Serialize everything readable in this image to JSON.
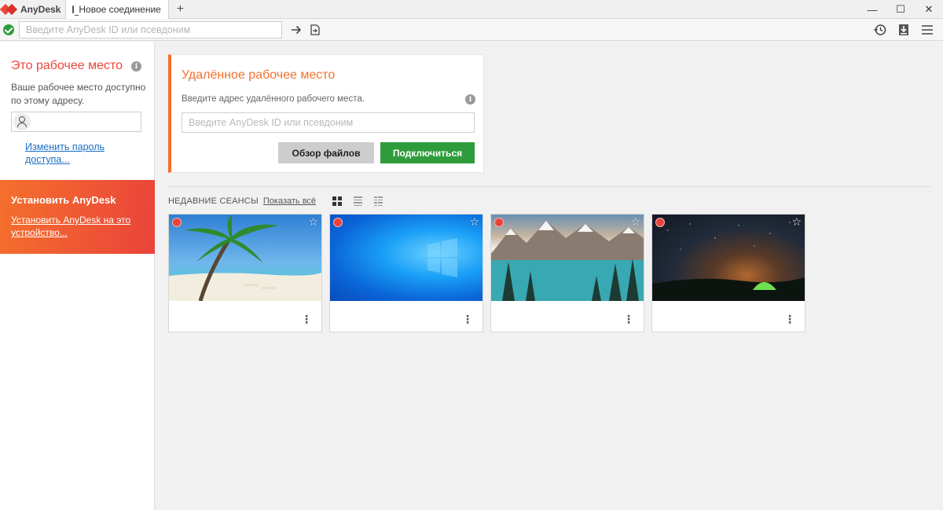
{
  "app": {
    "brand": "AnyDesk"
  },
  "tabs": [
    {
      "label": "Новое соединение"
    }
  ],
  "window_controls": {
    "minimize": "—",
    "maximize": "☐",
    "close": "✕"
  },
  "addressbar": {
    "placeholder": "Введите AnyDesk ID или псевдоним",
    "value": ""
  },
  "workspace": {
    "title": "Это рабочее место",
    "description": "Ваше рабочее место доступно по этому адресу.",
    "address_value": "",
    "change_password": "Изменить пароль доступа..."
  },
  "install": {
    "title": "Установить AnyDesk",
    "link": "Установить AnyDesk на это устройство..."
  },
  "remote": {
    "title": "Удалённое рабочее место",
    "description": "Введите адрес удалённого рабочего места.",
    "placeholder": "Введите AnyDesk ID или псевдоним",
    "value": "",
    "browse_files": "Обзор файлов",
    "connect": "Подключиться"
  },
  "recent": {
    "title": "НЕДАВНИЕ СЕАНСЫ",
    "show_all": "Показать всё",
    "view_mode": "grid",
    "sessions": [
      {
        "thumbnail": "beach-palm",
        "status": "offline",
        "favorite": false
      },
      {
        "thumbnail": "windows-wallpaper",
        "status": "offline",
        "favorite": false
      },
      {
        "thumbnail": "mountain-lake",
        "status": "offline",
        "favorite": false
      },
      {
        "thumbnail": "night-sky-tent",
        "status": "offline",
        "favorite": false
      }
    ]
  },
  "colors": {
    "accent": "#ef443b",
    "orange": "#f5702c",
    "green": "#2f9c3b",
    "link": "#1a6fc4"
  }
}
